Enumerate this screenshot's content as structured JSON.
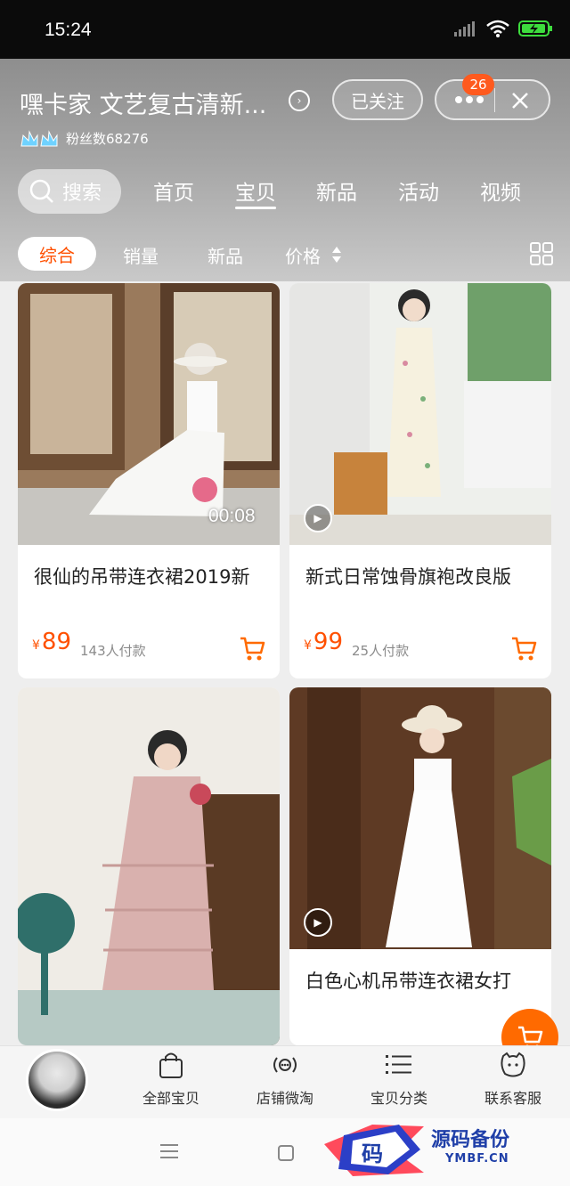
{
  "status_bar": {
    "time": "15:24"
  },
  "shop": {
    "name": "嘿卡家 文艺复古清新...",
    "fans_label": "粉丝数68276",
    "follow_label": "已关注",
    "more_badge": "26",
    "close_icon": "close-icon",
    "more_icon": "more-dots-icon"
  },
  "search": {
    "label": "搜索",
    "icon": "search-icon"
  },
  "nav_tabs": [
    {
      "label": "首页"
    },
    {
      "label": "宝贝",
      "active": true
    },
    {
      "label": "新品"
    },
    {
      "label": "活动"
    },
    {
      "label": "视频"
    }
  ],
  "filters": {
    "active": "综合",
    "items": [
      {
        "label": "销量"
      },
      {
        "label": "新品"
      },
      {
        "label": "价格"
      }
    ],
    "price_icon": "sort-arrows-icon",
    "layout_icon": "grid-view-icon"
  },
  "products": [
    {
      "title": "很仙的吊带连衣裙2019新",
      "currency": "¥",
      "price": "89",
      "sold": "143人付款",
      "video_duration": "00:08"
    },
    {
      "title": "新式日常蚀骨旗袍改良版",
      "currency": "¥",
      "price": "99",
      "sold": "25人付款"
    },
    {
      "title": ""
    },
    {
      "title": "白色心机吊带连衣裙女打"
    }
  ],
  "bottom_tabs": [
    {
      "label": "全部宝贝",
      "icon": "shopping-bag-icon"
    },
    {
      "label": "店铺微淘",
      "icon": "broadcast-icon"
    },
    {
      "label": "宝贝分类",
      "icon": "category-list-icon"
    },
    {
      "label": "联系客服",
      "icon": "chat-face-icon"
    }
  ],
  "watermark": {
    "brand": "源码备份",
    "domain": "YMBF.CN",
    "glyph": "码"
  },
  "colors": {
    "accent": "#ff5000",
    "fab": "#ff6a00",
    "header": "#9e9e9e"
  }
}
